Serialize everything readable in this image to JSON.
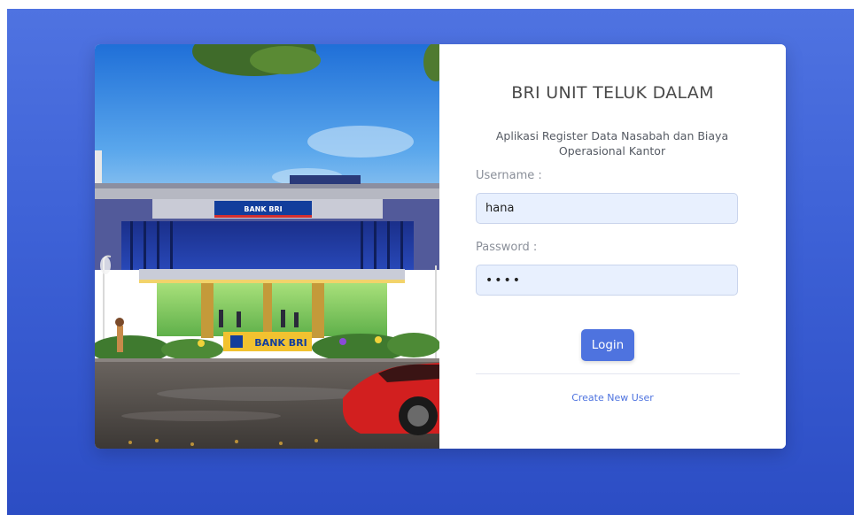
{
  "card": {
    "title": "BRI UNIT TELUK DALAM",
    "subtitle": "Aplikasi Register Data Nasabah dan Biaya Operasional Kantor"
  },
  "form": {
    "username_label": "Username :",
    "username_value": "hana",
    "password_label": "Password :",
    "password_value": "hana",
    "login_label": "Login",
    "create_user_label": "Create New User"
  },
  "photo": {
    "top_sign": "BANK BRI",
    "main_sign": "BANK BRI"
  },
  "colors": {
    "background": "#3f63d8",
    "accent": "#4e73df",
    "input_bg": "#e8f0fe"
  }
}
